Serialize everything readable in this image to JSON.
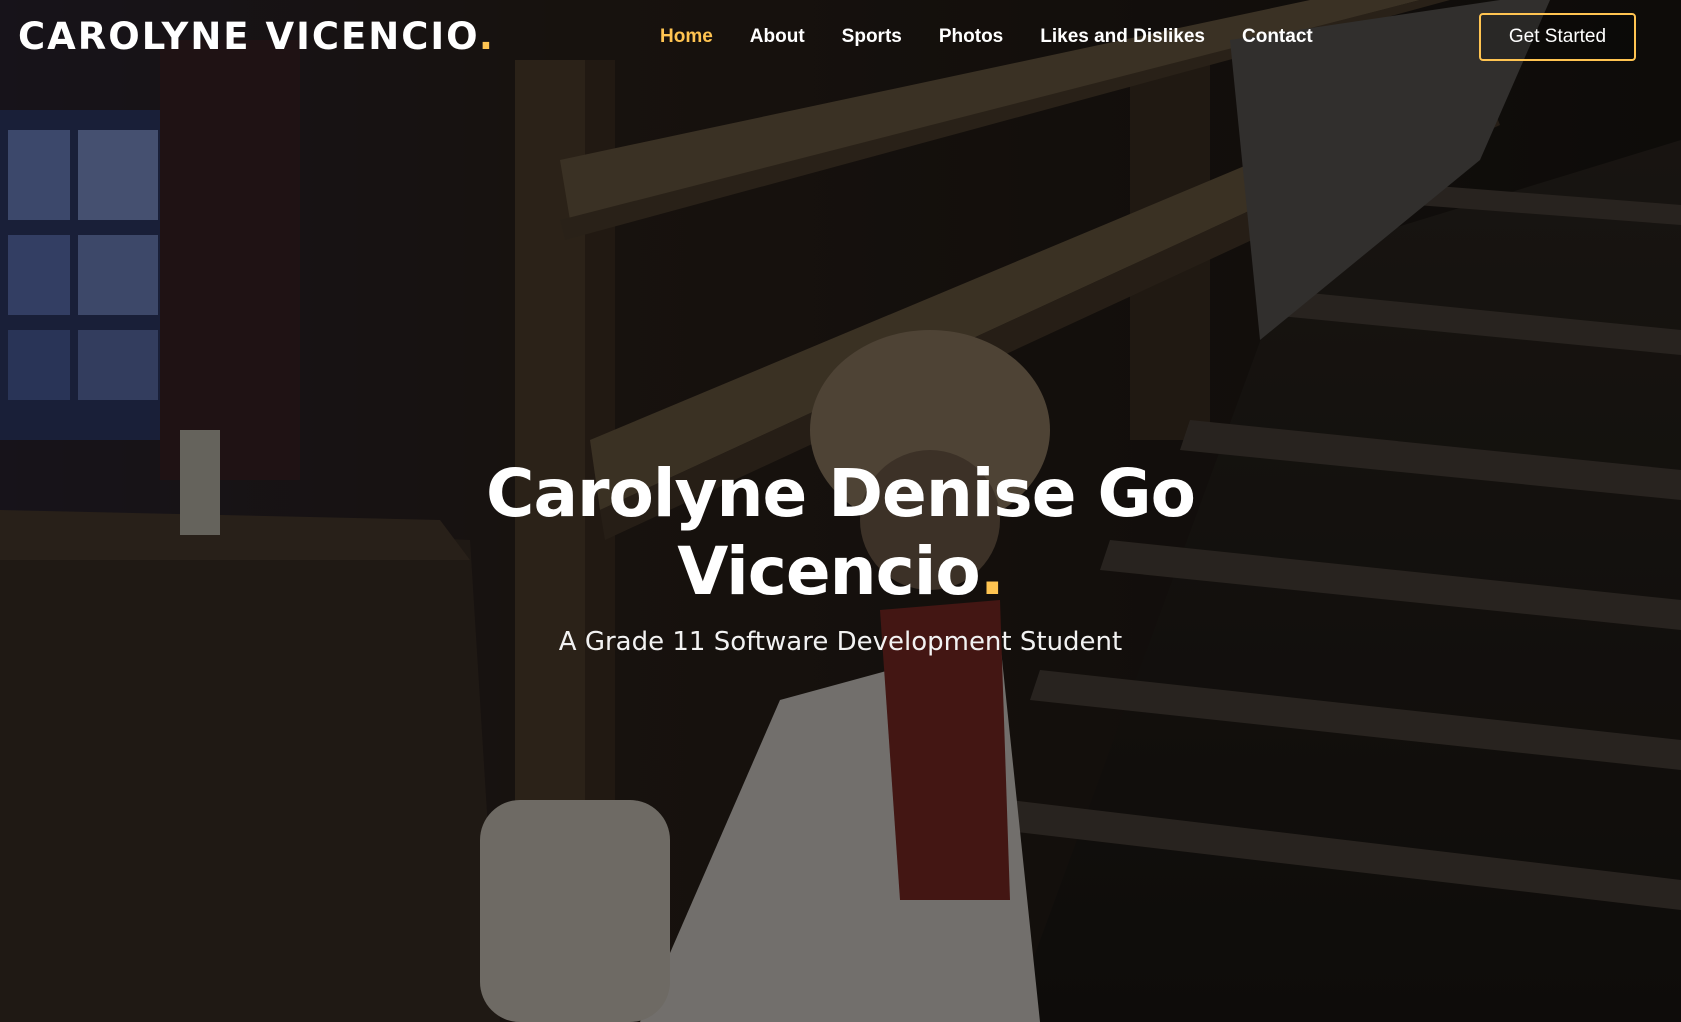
{
  "header": {
    "logo": {
      "name": "CAROLYNE VICENCIO",
      "dot": "."
    },
    "nav": [
      {
        "label": "Home",
        "active": true
      },
      {
        "label": "About",
        "active": false
      },
      {
        "label": "Sports",
        "active": false
      },
      {
        "label": "Photos",
        "active": false
      },
      {
        "label": "Likes and Dislikes",
        "active": false
      },
      {
        "label": "Contact",
        "active": false
      }
    ],
    "cta_label": "Get Started"
  },
  "hero": {
    "title": "Carolyne Denise Go Vicencio",
    "title_dot": ".",
    "subtitle": "A Grade 11 Software Development Student"
  },
  "theme": {
    "accent": "#ffc451",
    "text": "#ffffff"
  }
}
